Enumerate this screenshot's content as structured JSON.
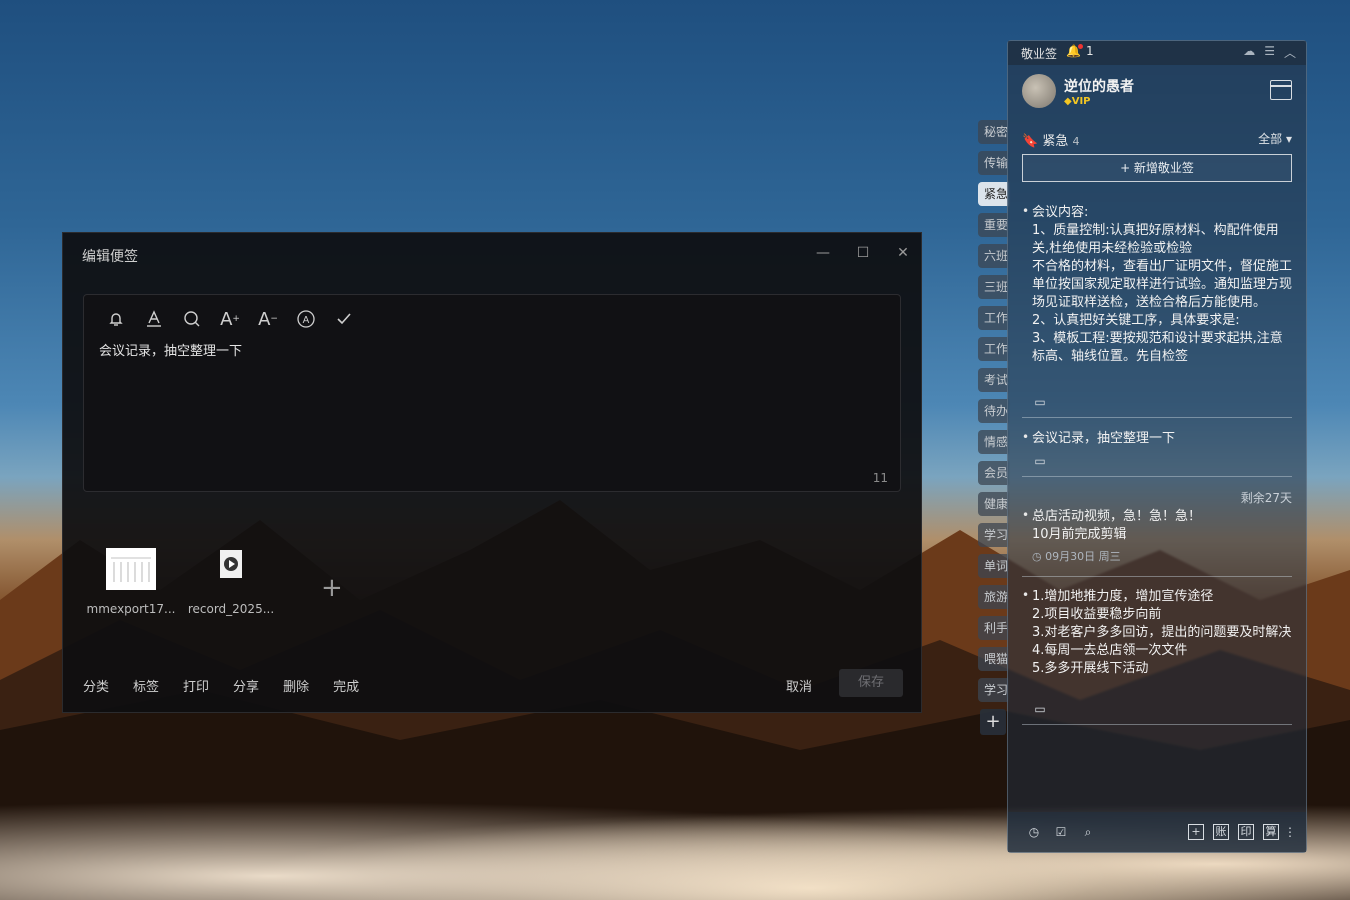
{
  "editor": {
    "title": "编辑便签",
    "text": "会议记录，抽空整理一下",
    "counter": "11",
    "attachments": [
      {
        "name": "mmexport17..."
      },
      {
        "name": "record_2025..."
      }
    ],
    "actions": [
      "分类",
      "标签",
      "打印",
      "分享",
      "删除",
      "完成"
    ],
    "cancel": "取消",
    "save": "保存"
  },
  "tabs": [
    "秘密",
    "传输",
    "紧急",
    "重要",
    "六班",
    "三班",
    "工作",
    "工作",
    "考试",
    "待办",
    "情感",
    "会员",
    "健康",
    "学习",
    "单词",
    "旅游",
    "利手",
    "喂猫",
    "学习"
  ],
  "panel": {
    "app_name": "敬业签",
    "bell_count": "1",
    "username": "逆位的愚者",
    "vip": "VIP",
    "filter": "紧急",
    "filter_count": "4",
    "all": "全部",
    "add_note": "+ 新增敬业签",
    "remaining": "剩余27天",
    "notes": [
      {
        "text": "会议内容:\n1、质量控制:认真把好原材料、构配件使用关,杜绝使用未经检验或检验\n不合格的材料，查看出厂证明文件，督促施工单位按国家规定取样进行试验。通知监理方现场见证取样送检，送检合格后方能使用。\n2、认真把好关键工序，具体要求是:\n3、模板工程:要按规范和设计要求起拱,注意标高、轴线位置。先自检签"
      },
      {
        "text": "会议记录，抽空整理一下"
      },
      {
        "text": "总店活动视频，急！急！急！\n10月前完成剪辑",
        "meta": "09月30日 周三"
      },
      {
        "text": "1.增加地推力度，增加宣传途径\n2.项目收益要稳步向前\n3.对老客户多多回访，提出的问题要及时解决\n4.每周一去总店领一次文件\n5.多多开展线下活动"
      }
    ],
    "bottom_left_icons": [
      "clock-icon",
      "checklist-icon",
      "search-icon"
    ],
    "bottom_right_icons": [
      "+",
      "账",
      "印",
      "算"
    ]
  }
}
